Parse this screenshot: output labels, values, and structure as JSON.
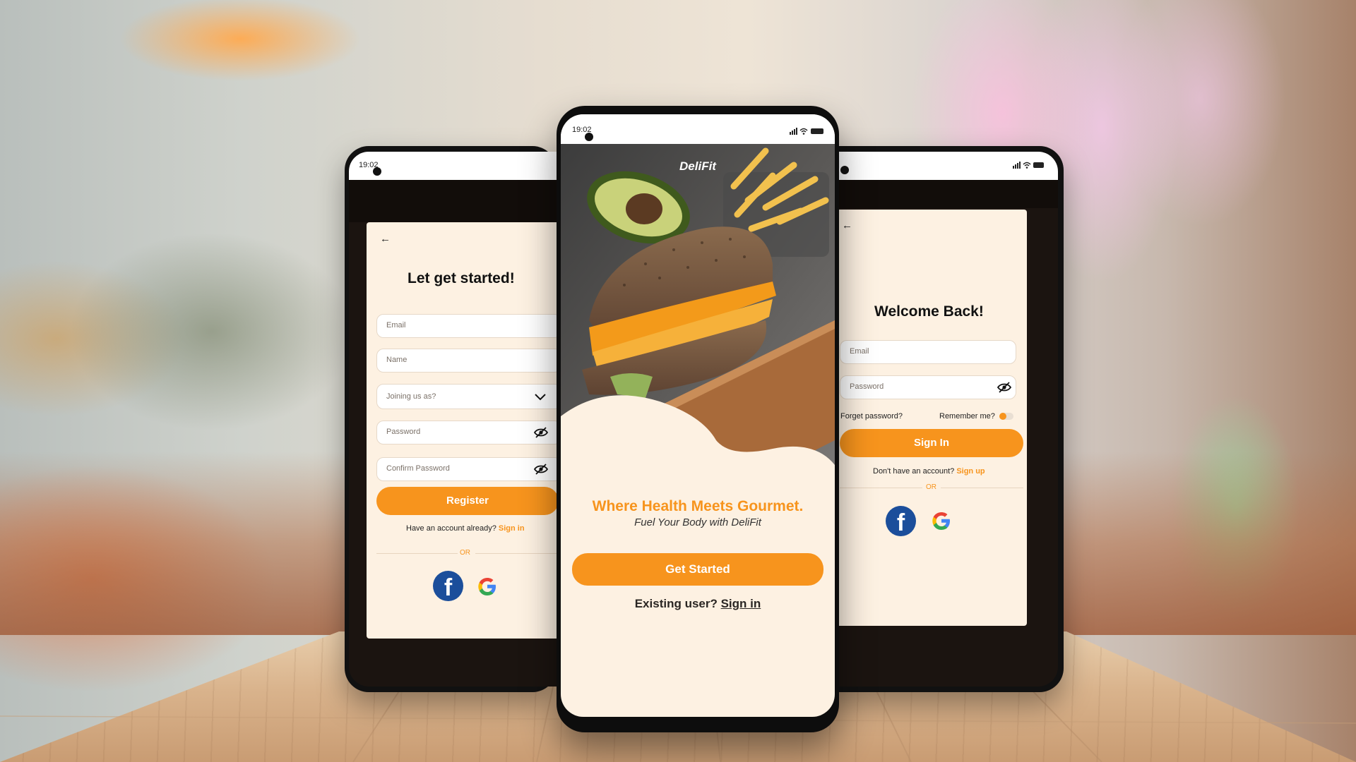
{
  "colors": {
    "accent": "#f7941d",
    "card_bg": "#fdf1e2",
    "facebook": "#1b4e9b"
  },
  "left_phone": {
    "status_time": "19:02",
    "title": "Let get started!",
    "fields": {
      "email": "Email",
      "name": "Name",
      "joining": "Joining us as?",
      "password": "Password",
      "confirm": "Confirm Password"
    },
    "register_label": "Register",
    "have_account": "Have an account already?",
    "signin_link": "Sign in",
    "or": "OR",
    "icons": [
      "back-arrow-icon",
      "chevron-down-icon",
      "eye-off-icon",
      "facebook-icon",
      "google-icon"
    ]
  },
  "center_phone": {
    "status_time": "19:02",
    "brand": "DeliFit",
    "headline": "Where Health Meets Gourmet.",
    "subline": "Fuel Your Body with DeliFit",
    "get_started": "Get Started",
    "existing_user": "Existing user?",
    "signin_link": "Sign in"
  },
  "right_phone": {
    "title": "Welcome Back!",
    "fields": {
      "email": "Email",
      "password": "Password"
    },
    "forgot": "Forget password?",
    "remember": "Remember me?",
    "remember_on": false,
    "signin_label": "Sign In",
    "no_account": "Don't have an account?",
    "signup_link": "Sign up",
    "or": "OR"
  }
}
